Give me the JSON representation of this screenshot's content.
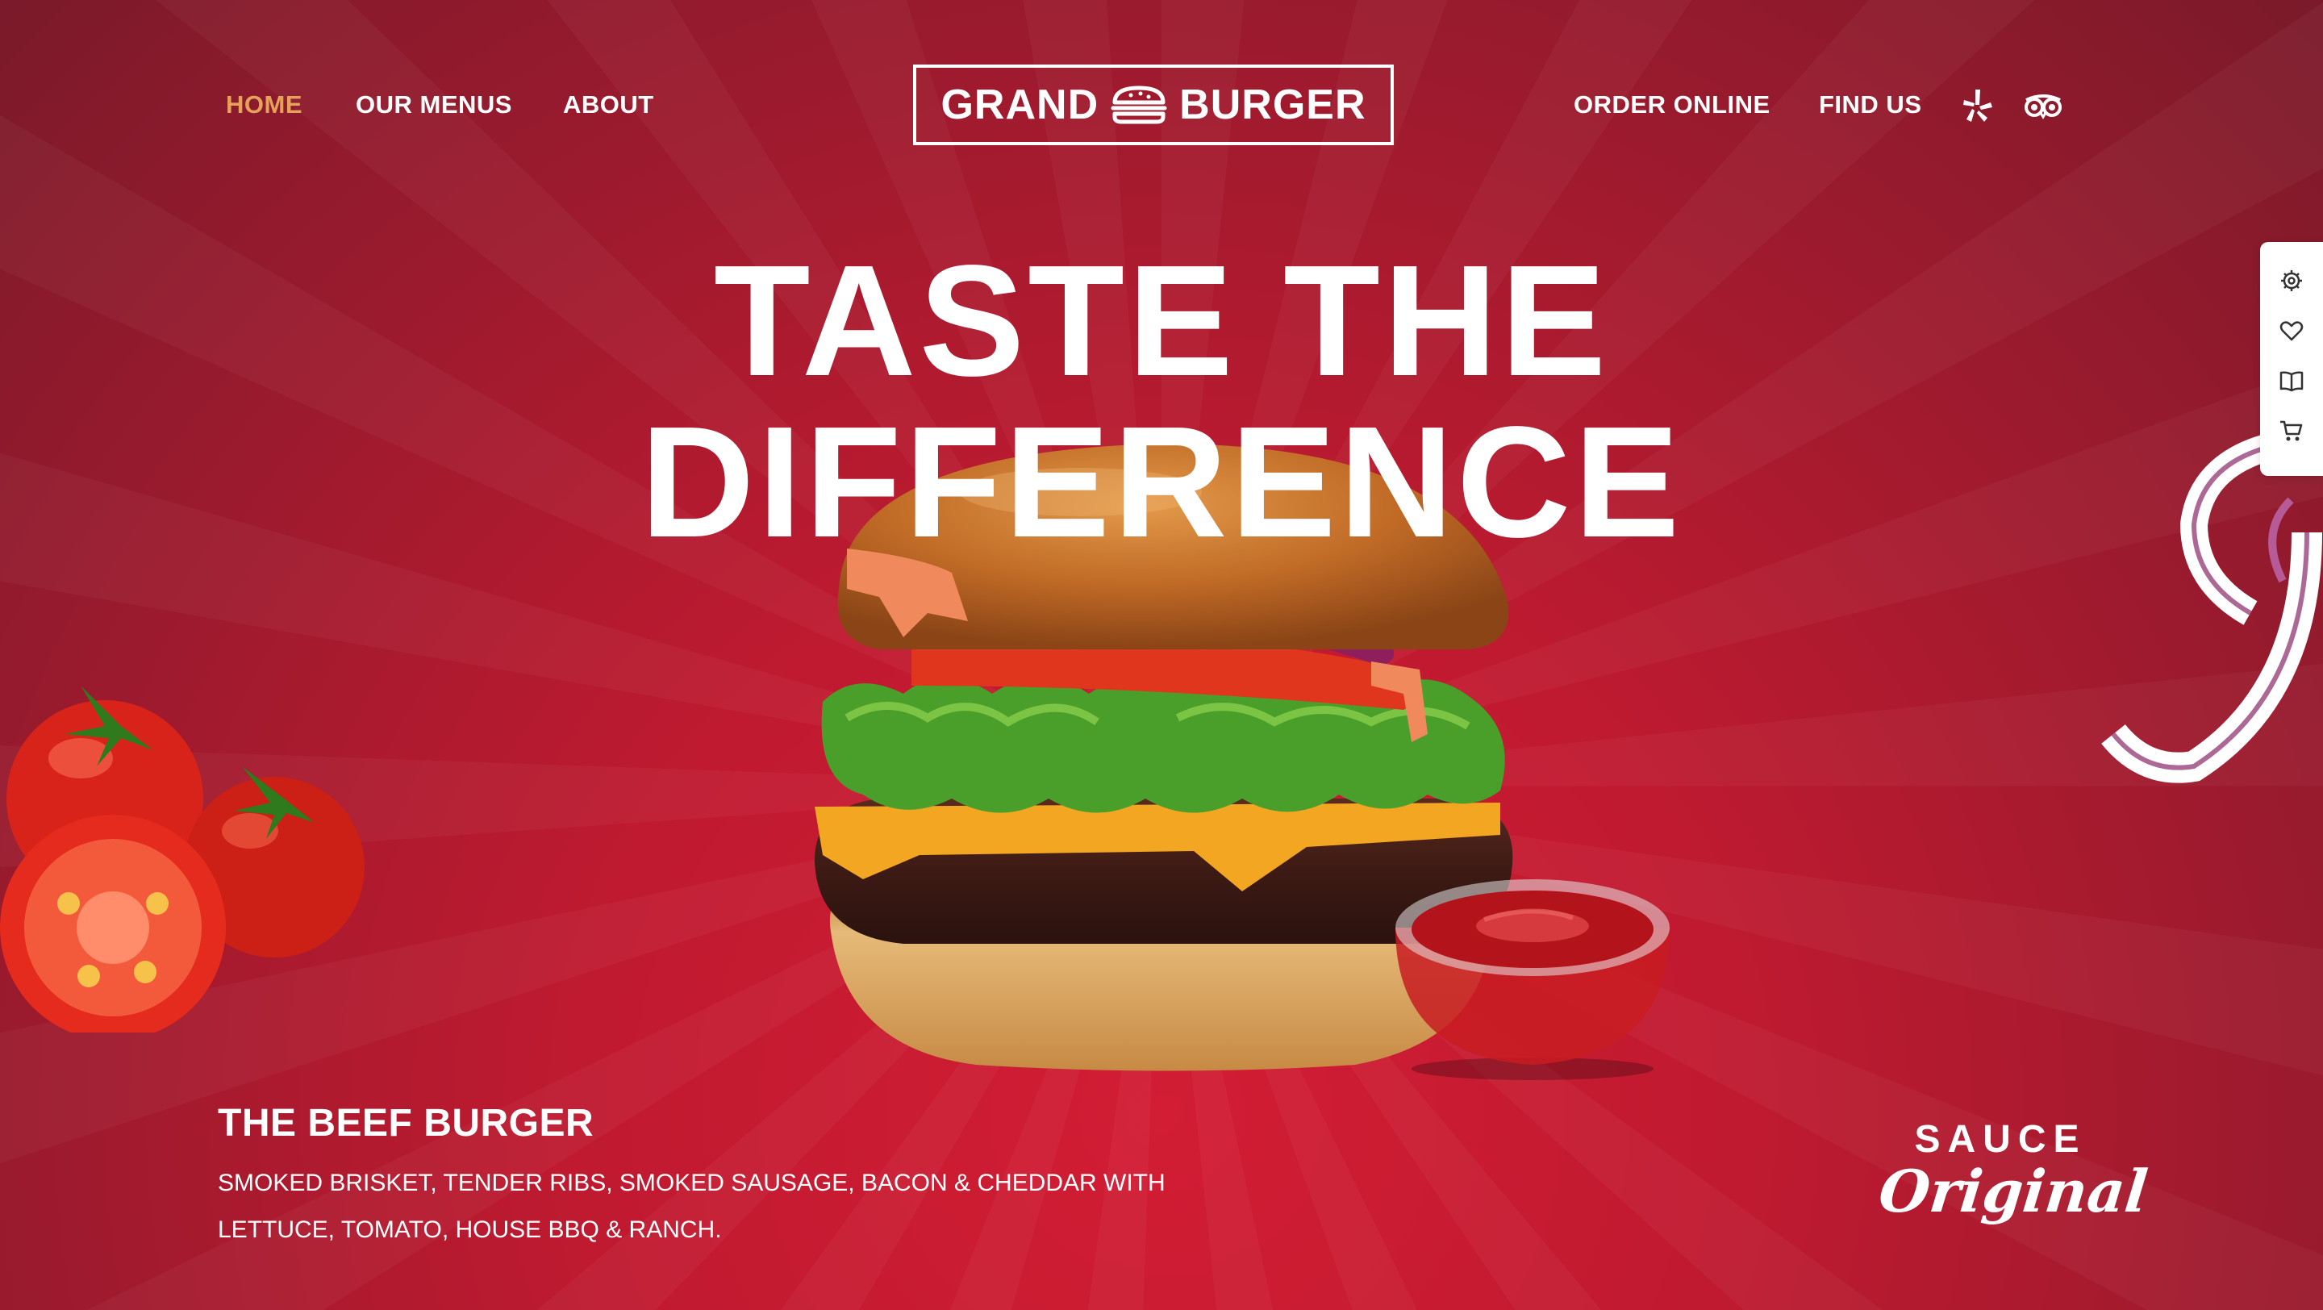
{
  "nav": {
    "left_items": [
      {
        "label": "HOME",
        "active": true
      },
      {
        "label": "OUR MENUS",
        "active": false
      },
      {
        "label": "ABOUT",
        "active": false
      }
    ],
    "logo": {
      "left_text": "GRAND",
      "right_text": "BURGER",
      "icon": "burger-icon"
    },
    "right_items": [
      {
        "label": "ORDER ONLINE"
      },
      {
        "label": "FIND US"
      }
    ],
    "social_icons": [
      "yelp-icon",
      "tripadvisor-icon"
    ],
    "active_color": "#e6a25a"
  },
  "hero": {
    "headline_line1": "TASTE THE",
    "headline_line2": "DIFFERENCE"
  },
  "sidebar": {
    "icons": [
      "gear-icon",
      "heart-icon",
      "book-icon",
      "cart-icon"
    ]
  },
  "caption": {
    "title": "THE BEEF BURGER",
    "description": "SMOKED BRISKET, TENDER RIBS, SMOKED SAUSAGE, BACON & CHEDDAR WITH LETTUCE, TOMATO, HOUSE BBQ & RANCH."
  },
  "badge": {
    "line1": "SAUCE",
    "line2": "Original"
  },
  "colors": {
    "background": "#c01a30",
    "text": "#ffffff",
    "accent": "#e6a25a"
  }
}
